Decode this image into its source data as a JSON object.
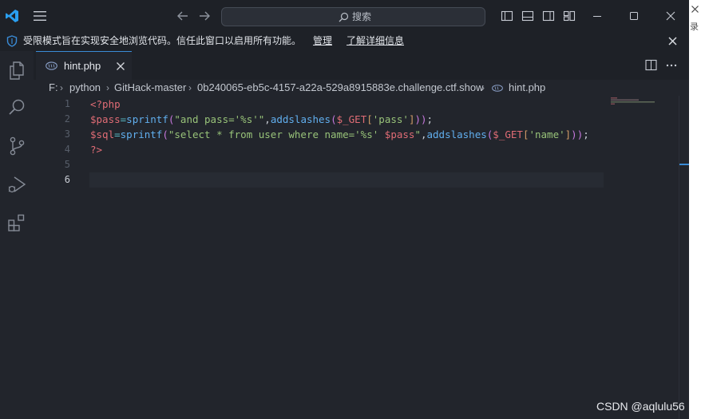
{
  "titlebar": {
    "search_placeholder": "搜索"
  },
  "infobar": {
    "message": "受限模式旨在实现安全地浏览代码。信任此窗口以启用所有功能。",
    "manage_link": "管理",
    "learn_more_link": "了解详细信息"
  },
  "tabs": [
    {
      "label": "hint.php",
      "active": true
    }
  ],
  "breadcrumb": {
    "parts": [
      "F:",
      "python",
      "GitHack-master",
      "0b240065-eb5c-4157-a22a-529a8915883e.challenge.ctf.show",
      "hint.php"
    ]
  },
  "editor": {
    "line_numbers": [
      "1",
      "2",
      "3",
      "4",
      "5",
      "6"
    ],
    "active_line": "6",
    "lines": [
      "<?php",
      "$pass=sprintf(\"and pass='%s'\",addslashes($_GET['pass']));",
      "$sql=sprintf(\"select * from user where name='%s' $pass\",addslashes($_GET['name']));",
      "?>",
      "",
      ""
    ]
  },
  "strip": {
    "char": "录"
  },
  "watermark": "CSDN @aqlulu56",
  "colors": {
    "accent": "#3a8bd6",
    "editor_bg": "#22252c",
    "titlebar_bg": "#1e2127",
    "keyword_red": "#e06c75",
    "function_blue": "#61afef",
    "string_green": "#98c379",
    "operator_cyan": "#56b6c2"
  },
  "icons": [
    "vscode-logo-icon",
    "menu-icon",
    "arrow-left-icon",
    "arrow-right-icon",
    "search-icon",
    "layout-icons",
    "minimize-icon",
    "maximize-icon",
    "close-icon",
    "shield-icon",
    "explorer-icon",
    "search-sidebar-icon",
    "source-control-icon",
    "run-debug-icon",
    "extensions-icon",
    "split-editor-icon",
    "more-actions-icon"
  ]
}
